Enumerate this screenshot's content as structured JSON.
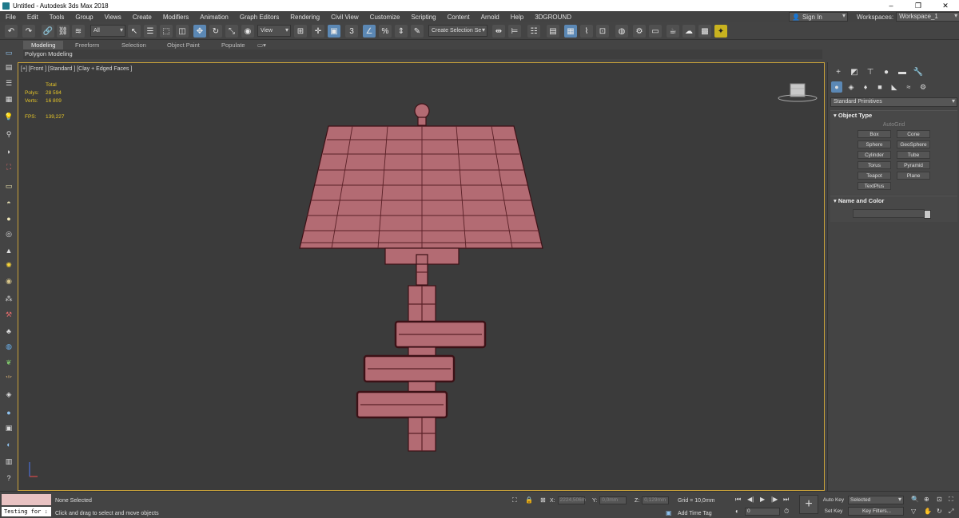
{
  "window": {
    "title": "Untitled - Autodesk 3ds Max 2018"
  },
  "menu": {
    "items": [
      "File",
      "Edit",
      "Tools",
      "Group",
      "Views",
      "Create",
      "Modifiers",
      "Animation",
      "Graph Editors",
      "Rendering",
      "Civil View",
      "Customize",
      "Scripting",
      "Content",
      "Arnold",
      "Help",
      "3DGROUND"
    ],
    "sign_in": "Sign In",
    "workspaces_label": "Workspaces:",
    "workspace_value": "Workspace_1"
  },
  "toolbar": {
    "filter_value": "All",
    "refcoord_value": "View",
    "selection_set_placeholder": "Create Selection Se"
  },
  "ribbon": {
    "tabs": [
      "Modeling",
      "Freeform",
      "Selection",
      "Object Paint",
      "Populate"
    ],
    "sub_label": "Polygon Modeling"
  },
  "viewport": {
    "label": "[+] [Front ] [Standard ] [Clay + Edged Faces ]",
    "stats": {
      "total_label": "Total",
      "polys_label": "Polys:",
      "polys_value": "28 594",
      "verts_label": "Verts:",
      "verts_value": "16 809",
      "fps_label": "FPS:",
      "fps_value": "139,227"
    },
    "model_color": "#b36b73"
  },
  "command_panel": {
    "category": "Standard Primitives",
    "object_type_title": "Object Type",
    "autogrid": "AutoGrid",
    "buttons": [
      "Box",
      "Cone",
      "Sphere",
      "GeoSphere",
      "Cylinder",
      "Tube",
      "Torus",
      "Pyramid",
      "Teapot",
      "Plane",
      "TextPlus"
    ],
    "name_color_title": "Name and Color"
  },
  "status": {
    "maxscript_text": "Testing for :",
    "selection": "None Selected",
    "prompt": "Click and drag to select and move objects",
    "x_label": "X:",
    "x_value": "2224,506m",
    "y_label": "Y:",
    "y_value": "0,0mm",
    "z_label": "Z:",
    "z_value": "0,129mm",
    "grid": "Grid = 10,0mm",
    "add_time_tag": "Add Time Tag",
    "frame_value": "0",
    "auto_key": "Auto Key",
    "set_key": "Set Key",
    "key_mode": "Selected",
    "key_filters": "Key Filters..."
  }
}
